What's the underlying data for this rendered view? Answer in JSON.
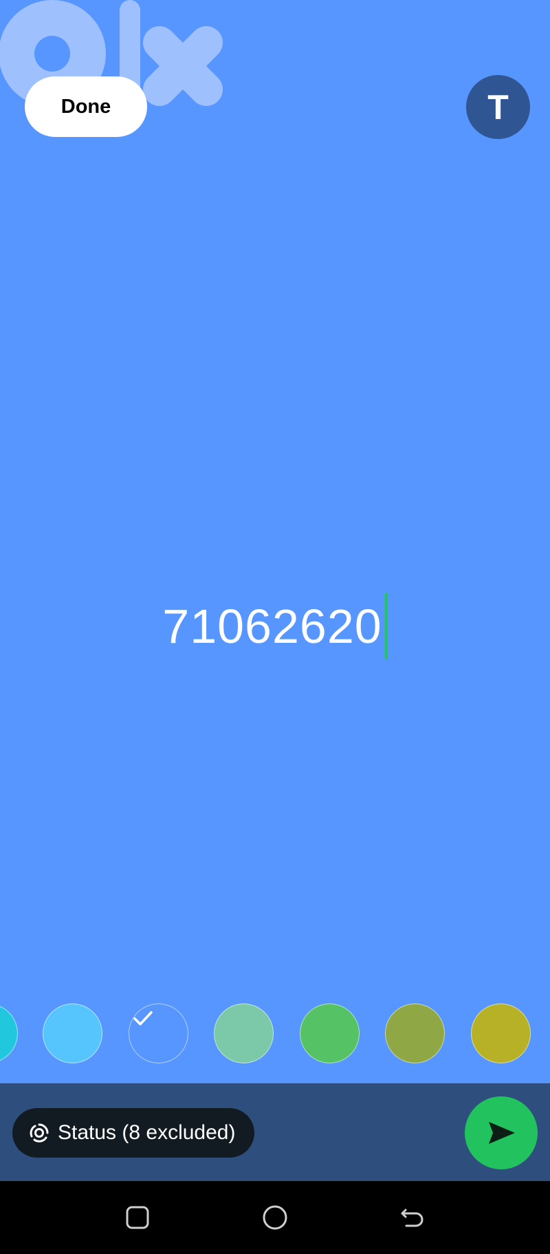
{
  "top_bar": {
    "done_label": "Done",
    "text_style_label": "T",
    "watermark_icon": "olx-logo-icon"
  },
  "editor": {
    "status_text": "71062620",
    "caret_color": "#22c55e"
  },
  "background_color": "#5696fe",
  "color_palette": {
    "swatches": [
      {
        "color": "#21c8dd",
        "selected": false
      },
      {
        "color": "#57c5fd",
        "selected": false
      },
      {
        "color": "#5696fe",
        "selected": true
      },
      {
        "color": "#7bc9a9",
        "selected": false
      },
      {
        "color": "#54c265",
        "selected": false
      },
      {
        "color": "#8fa845",
        "selected": false
      },
      {
        "color": "#b7b128",
        "selected": false
      }
    ]
  },
  "bottom_bar": {
    "status_chip_label": "Status (8 excluded)",
    "status_chip_icon": "status-ring-icon",
    "send_icon": "send-arrow-icon",
    "send_color": "#22c35e"
  },
  "nav_bar": {
    "recents_icon": "recents-square-icon",
    "home_icon": "home-circle-icon",
    "back_icon": "back-arrow-icon"
  }
}
